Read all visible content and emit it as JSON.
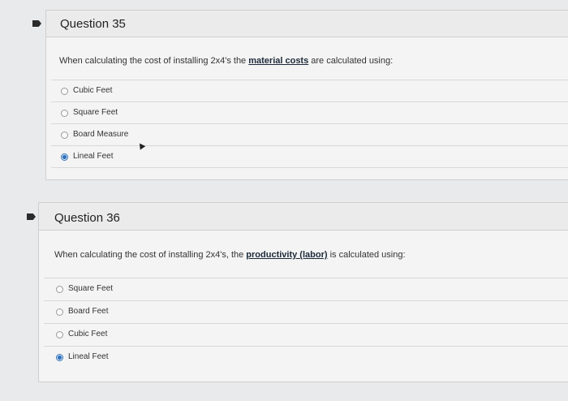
{
  "q35": {
    "title": "Question 35",
    "text_before": "When calculating the cost of installing 2x4's the ",
    "text_link": "material costs",
    "text_after": " are calculated using:",
    "options": [
      {
        "label": "Cubic Feet",
        "selected": false
      },
      {
        "label": "Square Feet",
        "selected": false
      },
      {
        "label": "Board Measure",
        "selected": false
      },
      {
        "label": "Lineal Feet",
        "selected": true
      }
    ]
  },
  "q36": {
    "title": "Question 36",
    "text_before": "When calculating the cost of installing 2x4's, the ",
    "text_link": "productivity (labor)",
    "text_after": " is calculated using:",
    "options": [
      {
        "label": "Square Feet",
        "selected": false
      },
      {
        "label": "Board Feet",
        "selected": false
      },
      {
        "label": "Cubic Feet",
        "selected": false
      },
      {
        "label": "Lineal Feet",
        "selected": true
      }
    ]
  }
}
